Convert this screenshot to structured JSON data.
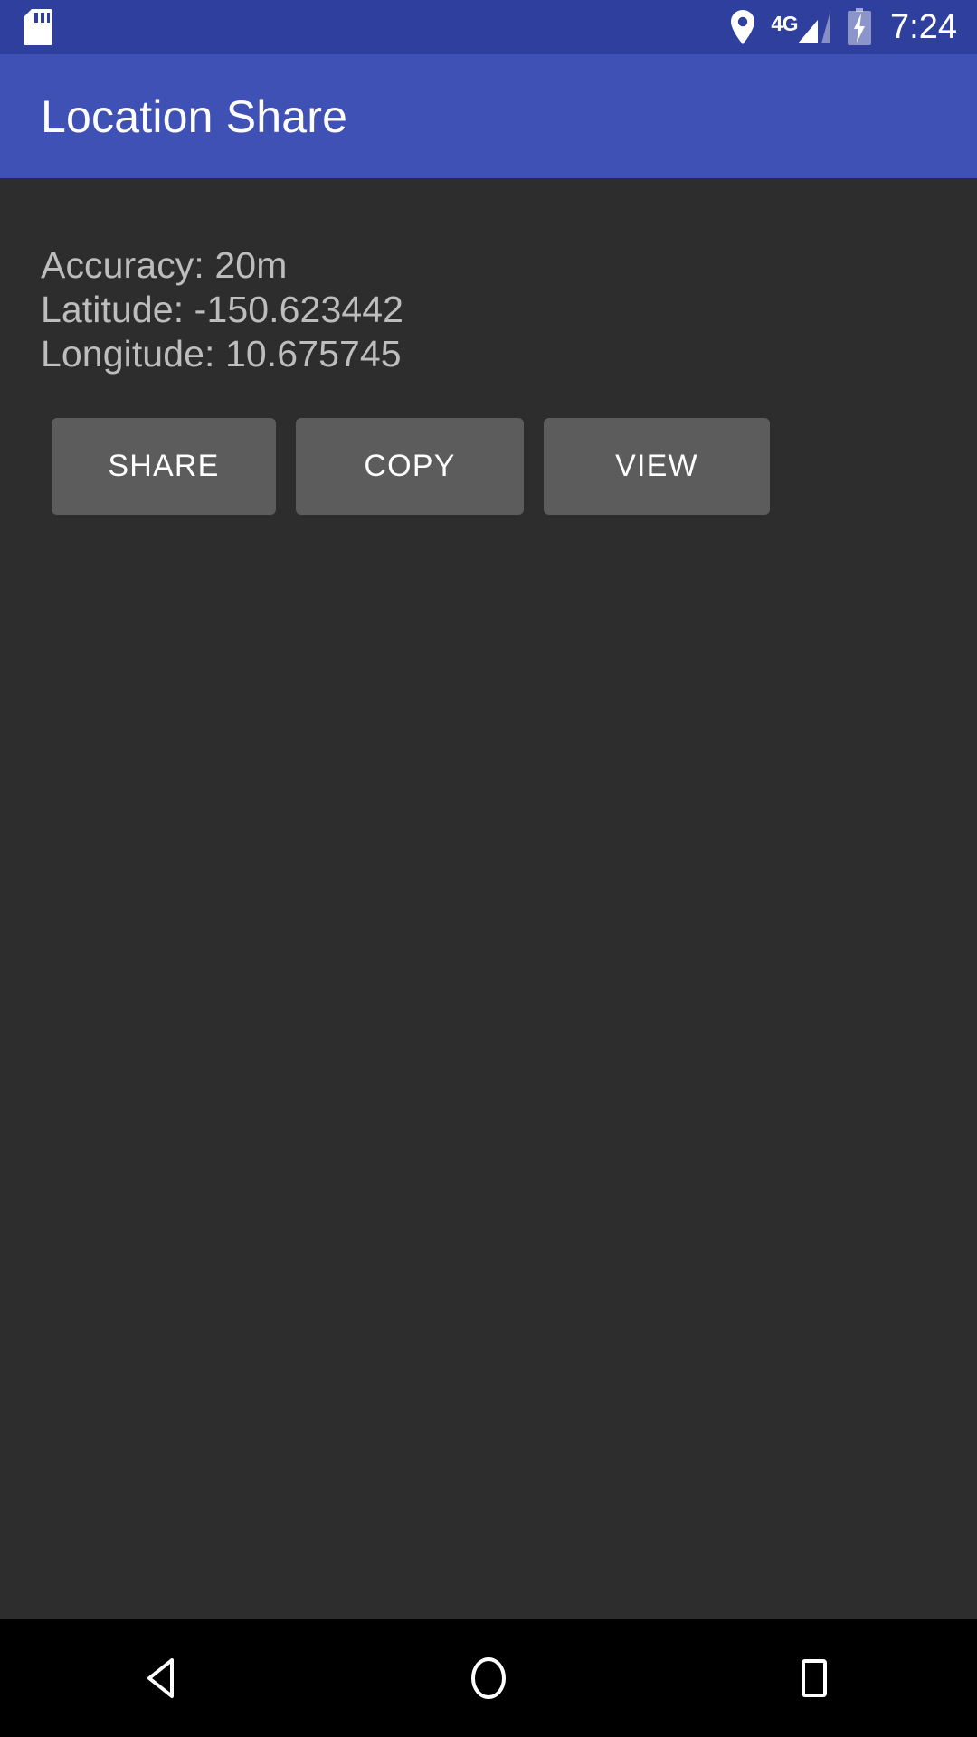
{
  "status_bar": {
    "sd_card_icon": "sd-card-icon",
    "location_icon": "location-pin-icon",
    "network_label": "4G",
    "signal_icon": "signal-bars-icon",
    "battery_icon": "battery-charging-icon",
    "time": "7:24",
    "background_color": "#2f3f9e",
    "foreground_color": "#ffffff"
  },
  "app_bar": {
    "title": "Location Share",
    "background_color": "#3f51b5",
    "text_color": "#ffffff"
  },
  "content": {
    "background_color": "#2d2d2d",
    "text_color": "#bdbdbd",
    "info_lines": [
      "Accuracy: 20m",
      "Latitude: -150.623442",
      "Longitude: 10.675745"
    ],
    "accuracy_label": "Accuracy:",
    "accuracy_value": "20m",
    "latitude_label": "Latitude:",
    "latitude_value": "-150.623442",
    "longitude_label": "Longitude:",
    "longitude_value": "10.675745"
  },
  "buttons": {
    "background_color": "#5c5c5c",
    "text_color": "#ffffff",
    "share_label": "SHARE",
    "copy_label": "COPY",
    "view_label": "VIEW"
  },
  "nav_bar": {
    "background_color": "#000000",
    "icon_color": "#ffffff",
    "back_icon": "back-triangle-icon",
    "home_icon": "home-circle-icon",
    "recents_icon": "recents-square-icon"
  }
}
